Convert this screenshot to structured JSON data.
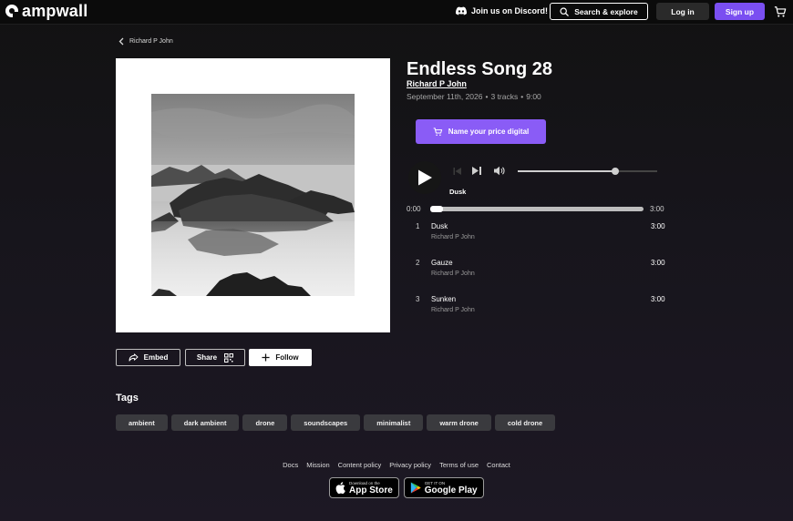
{
  "header": {
    "brand": "ampwall",
    "discord_label": "Join us on Discord!",
    "search_label": "Search & explore",
    "login_label": "Log in",
    "signup_label": "Sign up"
  },
  "breadcrumb": {
    "artist": "Richard P John"
  },
  "album": {
    "title": "Endless Song 28",
    "artist": "Richard P John",
    "date": "September 11th, 2026",
    "track_count": "3 tracks",
    "duration": "9:00",
    "separator": "•",
    "price_label": "Name your price digital"
  },
  "player": {
    "now_playing": "Dusk",
    "time_current": "0:00",
    "time_total": "3:00",
    "progress": 0,
    "volume": 0.7
  },
  "tracks": [
    {
      "num": "1",
      "title": "Dusk",
      "artist": "Richard P John",
      "duration": "3:00"
    },
    {
      "num": "2",
      "title": "Gauze",
      "artist": "Richard P John",
      "duration": "3:00"
    },
    {
      "num": "3",
      "title": "Sunken",
      "artist": "Richard P John",
      "duration": "3:00"
    }
  ],
  "actions": {
    "embed_label": "Embed",
    "share_label": "Share",
    "follow_label": "Follow"
  },
  "tags": {
    "heading": "Tags",
    "items": [
      "ambient",
      "dark ambient",
      "drone",
      "soundscapes",
      "minimalist",
      "warm drone",
      "cold drone"
    ]
  },
  "footer": {
    "links": [
      "Docs",
      "Mission",
      "Content policy",
      "Privacy policy",
      "Terms of use",
      "Contact"
    ],
    "app_store_small": "Download on the",
    "app_store_big": "App Store",
    "google_play_small": "GET IT ON",
    "google_play_big": "Google Play"
  },
  "colors": {
    "accent": "#7a4ff1",
    "price_button": "#8a5cf6",
    "tag_bg": "#3a3a3e"
  }
}
